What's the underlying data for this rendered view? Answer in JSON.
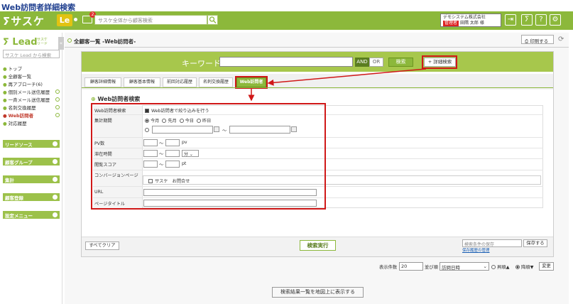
{
  "caption": "Web訪問者詳細検索",
  "header": {
    "logo": "ⵢサスケ",
    "le_badge": "Le",
    "notification_count": "2",
    "search_placeholder": "サスケ全体から顧客検索",
    "company_line1": "デモシステム株式会社",
    "company_badge": "管理者",
    "company_line2": "田隅 太郎 様"
  },
  "sidebar": {
    "logo": "Lead",
    "logo_sub": "サスケ\nリード",
    "toggle": "«",
    "search_placeholder": "サスケ Lead から検索",
    "items": [
      {
        "label": "トップ"
      },
      {
        "label": "全顧客一覧"
      },
      {
        "label": "再アプローチ(6)"
      },
      {
        "label": "個別メール送信履歴"
      },
      {
        "label": "一斉メール送信履歴"
      },
      {
        "label": "名刺交換履歴"
      },
      {
        "label": "Web訪問者"
      },
      {
        "label": "対応履歴"
      }
    ],
    "sections": [
      {
        "label": "リードソース"
      },
      {
        "label": "顧客グループ"
      },
      {
        "label": "集計"
      },
      {
        "label": "顧客登録"
      },
      {
        "label": "設定メニュー"
      }
    ]
  },
  "main": {
    "breadcrumb": "全顧客一覧 -Web訪問者-",
    "print_label": "印刷する",
    "keyword_label": "キーワード",
    "and_label": "AND",
    "or_label": "OR",
    "search_label": "検索",
    "detail_search_label": "+ 詳細検索",
    "tabs": [
      {
        "label": "顧客詳細情報"
      },
      {
        "label": "顧客基本情報"
      },
      {
        "label": "前回対応履歴"
      },
      {
        "label": "名刺交換履歴"
      },
      {
        "label": "Web訪問者"
      }
    ],
    "section_title": "Web訪問者検索",
    "form": {
      "row1_label": "Web訪問者検索",
      "row1_check": "Web訪問者で絞り込みを行う",
      "row2_label": "集計期間",
      "period_options": [
        "今月",
        "先月",
        "今日",
        "昨日"
      ],
      "tilde": "〜",
      "pv_label": "PV数",
      "pv_unit": "pv",
      "stay_label": "滞在時間",
      "stay_unit": "分",
      "score_label": "閲覧スコア",
      "score_unit": "pt",
      "cv_label": "コンバージョンページ",
      "cv_option": "サスケ　お問合せ",
      "url_label": "URL",
      "title_label": "ページタイトル"
    },
    "clear_label": "すべてクリア",
    "exec_label": "検索実行",
    "save_placeholder": "検索条件の保存",
    "save_label": "保存する",
    "save_link": "保存履歴の管理",
    "count_label": "表示件数",
    "count_value": "20",
    "sort_label": "並び順",
    "sort_value": "訪問日時",
    "asc_label": "昇順▲",
    "desc_label": "降順▼",
    "change_label": "変更",
    "map_label": "検索結果一覧を地図上に表示する"
  },
  "colors": {
    "brand": "#8cb83b",
    "highlight": "#d01818"
  }
}
